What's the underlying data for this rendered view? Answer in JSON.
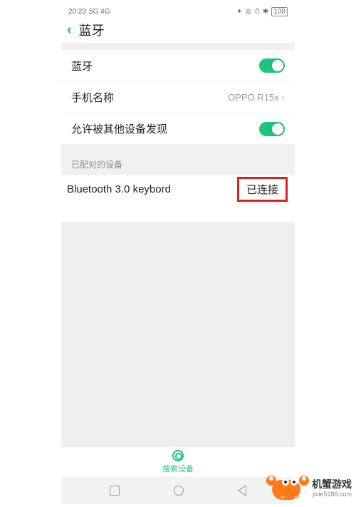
{
  "status_bar": {
    "time": "20:23",
    "signal_text": "5G 4G",
    "battery": "100"
  },
  "header": {
    "title": "蓝牙"
  },
  "rows": {
    "bluetooth_label": "蓝牙",
    "phone_name_label": "手机名称",
    "phone_name_value": "OPPO R15x",
    "discoverable_label": "允许被其他设备发现"
  },
  "paired": {
    "section_title": "已配对的设备",
    "device_name": "Bluetooth 3.0 keybord",
    "device_status": "已连接"
  },
  "search": {
    "label": "搜索设备"
  },
  "watermark": {
    "brand": "机蟹游戏",
    "url": "jixie5188.com"
  }
}
